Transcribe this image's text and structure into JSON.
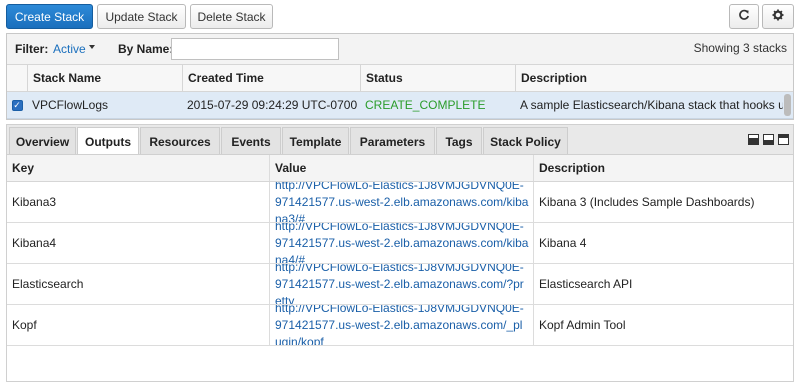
{
  "toolbar": {
    "create_label": "Create Stack",
    "update_label": "Update Stack",
    "delete_label": "Delete Stack",
    "refresh_icon": "refresh-icon",
    "settings_icon": "gear-icon"
  },
  "filter": {
    "label": "Filter:",
    "value": "Active",
    "by_name_label": "By Name:",
    "by_name_value": "",
    "showing": "Showing 3 stacks"
  },
  "stacks": {
    "columns": [
      "Stack Name",
      "Created Time",
      "Status",
      "Description"
    ],
    "rows": [
      {
        "selected": true,
        "name": "VPCFlowLogs",
        "created": "2015-07-29 09:24:29 UTC-0700",
        "status": "CREATE_COMPLETE",
        "description": "A sample Elasticsearch/Kibana stack that hooks up wi"
      }
    ]
  },
  "tabs": [
    "Overview",
    "Outputs",
    "Resources",
    "Events",
    "Template",
    "Parameters",
    "Tags",
    "Stack Policy"
  ],
  "active_tab": "Outputs",
  "outputs": {
    "columns": [
      "Key",
      "Value",
      "Description"
    ],
    "rows": [
      {
        "key": "Kibana3",
        "value": "http://VPCFlowLo-Elastics-1J8VMJGDVNQ0E-971421577.us-west-2.elb.amazonaws.com/kibana3/#",
        "description": "Kibana 3 (Includes Sample Dashboards)"
      },
      {
        "key": "Kibana4",
        "value": "http://VPCFlowLo-Elastics-1J8VMJGDVNQ0E-971421577.us-west-2.elb.amazonaws.com/kibana4/#",
        "description": "Kibana 4"
      },
      {
        "key": "Elasticsearch",
        "value": "http://VPCFlowLo-Elastics-1J8VMJGDVNQ0E-971421577.us-west-2.elb.amazonaws.com/?pretty",
        "description": "Elasticsearch API"
      },
      {
        "key": "Kopf",
        "value": "http://VPCFlowLo-Elastics-1J8VMJGDVNQ0E-971421577.us-west-2.elb.amazonaws.com/_plugin/kopf",
        "description": "Kopf Admin Tool"
      }
    ]
  },
  "colors": {
    "primary": "#1a6fbd",
    "status_complete": "#2a9c2a",
    "link": "#1a5fa8",
    "selected_row": "#dfeaf6"
  }
}
